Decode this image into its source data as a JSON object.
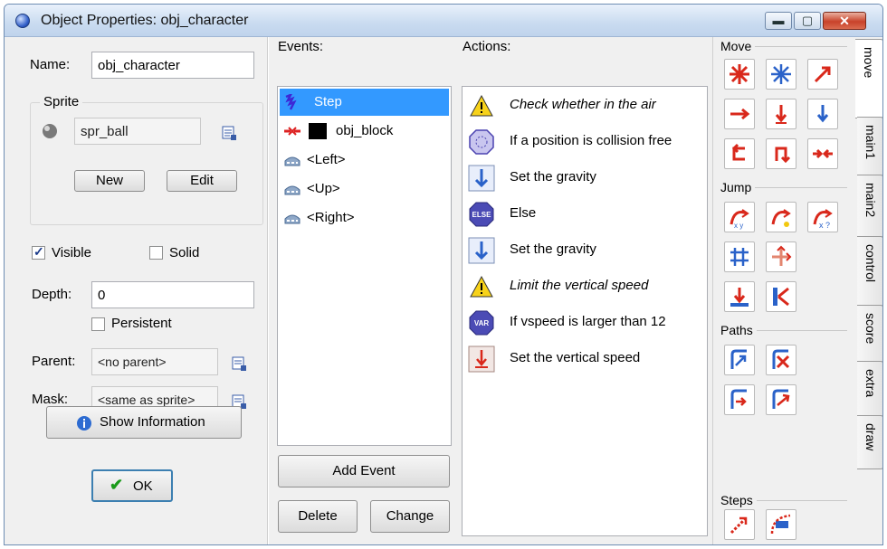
{
  "window": {
    "title": "Object Properties: obj_character"
  },
  "left": {
    "name_label": "Name:",
    "name_value": "obj_character",
    "sprite_group": "Sprite",
    "sprite_value": "spr_ball",
    "new_button": "New",
    "edit_button": "Edit",
    "visible_label": "Visible",
    "visible_checked": true,
    "solid_label": "Solid",
    "solid_checked": false,
    "depth_label": "Depth:",
    "depth_value": "0",
    "persistent_label": "Persistent",
    "persistent_checked": false,
    "parent_label": "Parent:",
    "parent_value": "<no parent>",
    "mask_label": "Mask:",
    "mask_value": "<same as sprite>",
    "show_info_button": "Show Information",
    "ok_button": "OK"
  },
  "events": {
    "label": "Events:",
    "items": [
      {
        "label": "Step",
        "icon": "step-icon",
        "selected": true
      },
      {
        "label": "obj_block",
        "icon": "collision-icon",
        "selected": false
      },
      {
        "label": "<Left>",
        "icon": "keyboard-icon",
        "selected": false
      },
      {
        "label": "<Up>",
        "icon": "keyboard-icon",
        "selected": false
      },
      {
        "label": "<Right>",
        "icon": "keyboard-icon",
        "selected": false
      }
    ],
    "add_event_button": "Add Event",
    "delete_button": "Delete",
    "change_button": "Change"
  },
  "actions": {
    "label": "Actions:",
    "items": [
      {
        "label": "Check whether in the air",
        "icon": "warning-icon",
        "italic": true
      },
      {
        "label": "If a position is collision free",
        "icon": "collision-free-icon",
        "italic": false
      },
      {
        "label": "Set the gravity",
        "icon": "gravity-icon",
        "italic": false
      },
      {
        "label": "Else",
        "icon": "else-icon",
        "italic": false
      },
      {
        "label": "Set the gravity",
        "icon": "gravity-icon",
        "italic": false
      },
      {
        "label": "Limit the vertical speed",
        "icon": "warning-icon",
        "italic": true
      },
      {
        "label": "If vspeed is larger than 12",
        "icon": "var-icon",
        "italic": false
      },
      {
        "label": "Set the vertical speed",
        "icon": "vspeed-icon",
        "italic": false
      }
    ]
  },
  "palette": {
    "sections": [
      "Move",
      "Jump",
      "Paths",
      "Steps"
    ]
  },
  "tabs": [
    "move",
    "main1",
    "main2",
    "control",
    "score",
    "extra",
    "draw"
  ]
}
